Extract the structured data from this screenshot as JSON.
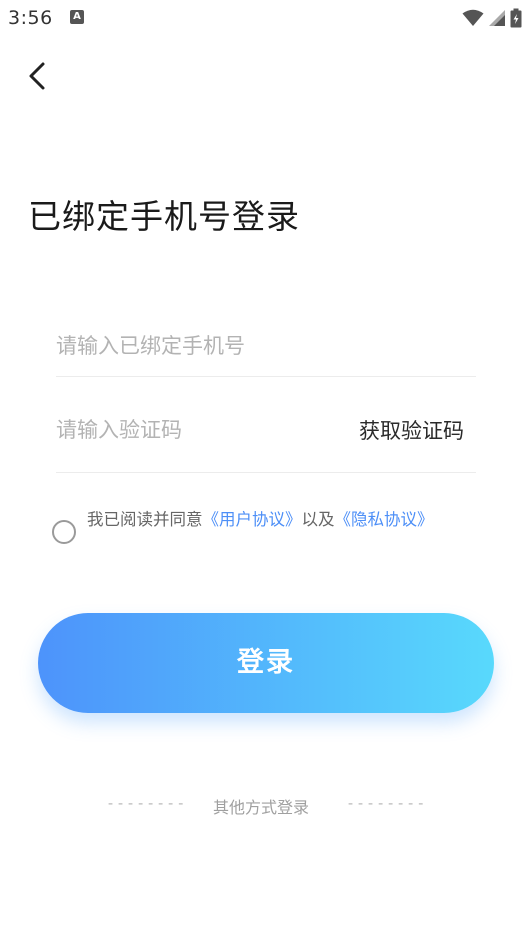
{
  "status_bar": {
    "time": "3:56",
    "notification_icon": "A",
    "icons": [
      "wifi-icon",
      "signal-icon",
      "battery-icon"
    ]
  },
  "header": {
    "back_icon": "chevron-left-icon"
  },
  "page": {
    "title": "已绑定手机号登录"
  },
  "form": {
    "phone_placeholder": "请输入已绑定手机号",
    "phone_value": "",
    "code_placeholder": "请输入验证码",
    "code_value": "",
    "get_code_label": "获取验证码"
  },
  "agreement": {
    "checked": false,
    "prefix": "我已阅读并同意",
    "user_agreement": "《用户协议》",
    "middle": "以及",
    "privacy_agreement": "《隐私协议》"
  },
  "login": {
    "button_label": "登录"
  },
  "other_login": {
    "label": "其他方式登录",
    "dashes_left": "--------",
    "dashes_right": "--------"
  },
  "colors": {
    "link": "#4d8ff7",
    "button_gradient_start": "#4d93fb",
    "button_gradient_end": "#58d9fc"
  }
}
